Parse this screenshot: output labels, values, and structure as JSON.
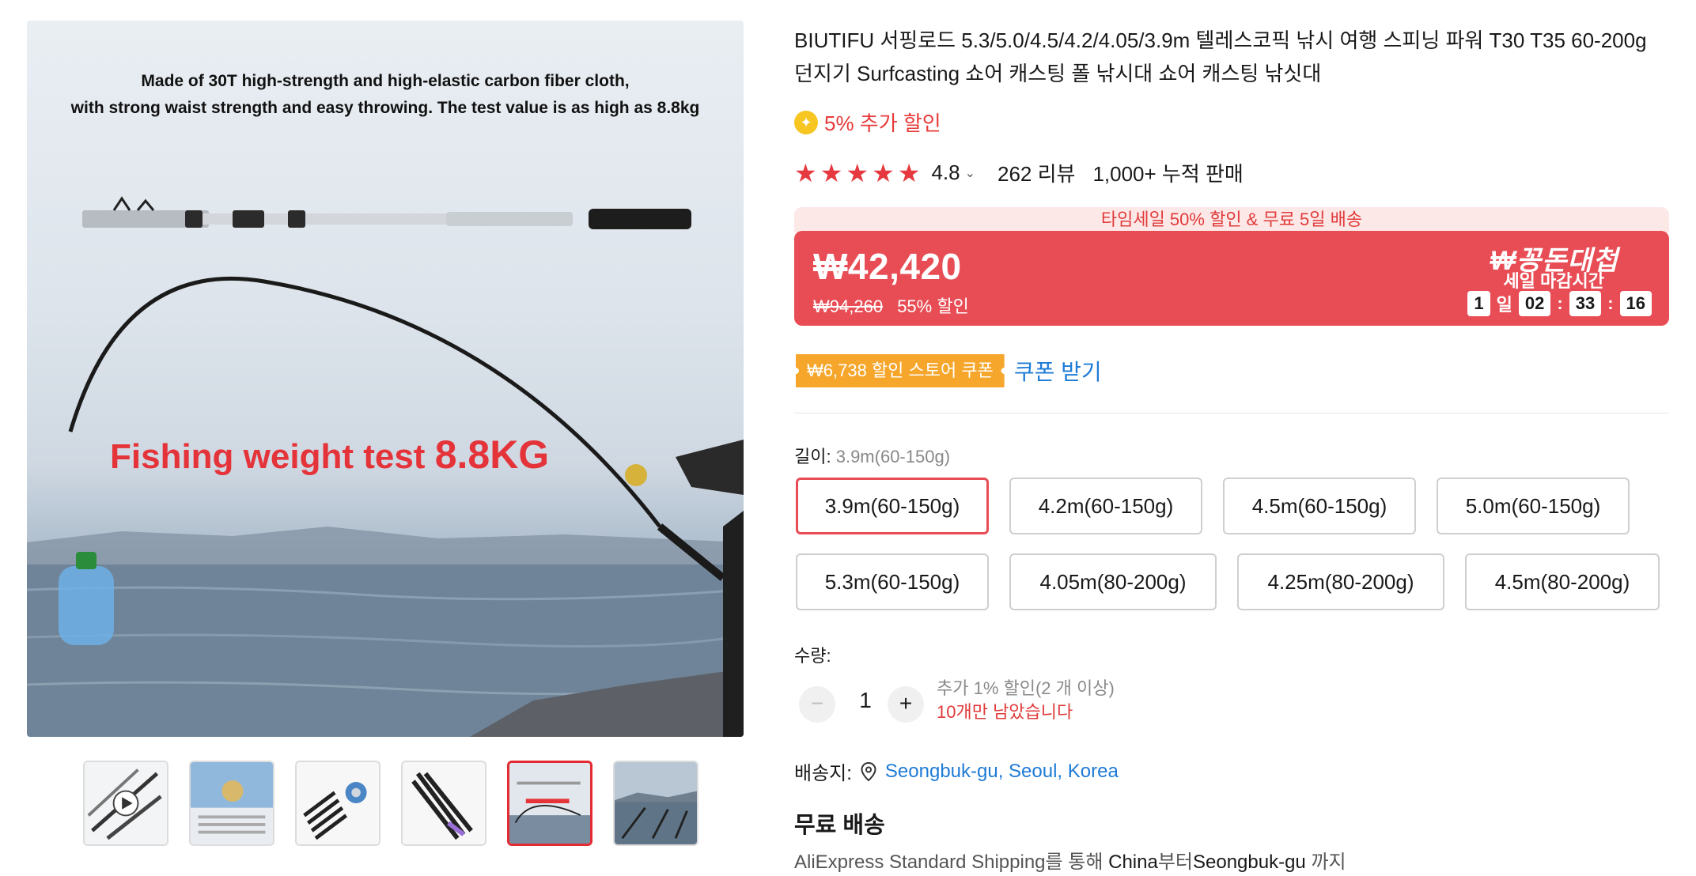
{
  "gallery": {
    "caption_line1": "Made of 30T high-strength and high-elastic carbon fiber cloth,",
    "caption_line2": "with strong waist strength and easy throwing. The test value is as high as 8.8kg",
    "headline": "Fishing weight test",
    "headline_value": "8.8KG",
    "thumbnails": [
      {
        "name": "thumb-1",
        "has_play_icon": true
      },
      {
        "name": "thumb-2"
      },
      {
        "name": "thumb-3"
      },
      {
        "name": "thumb-4"
      },
      {
        "name": "thumb-5",
        "active": true
      },
      {
        "name": "thumb-6"
      }
    ]
  },
  "product": {
    "title": "BIUTIFU 서핑로드 5.3/5.0/4.5/4.2/4.05/3.9m 텔레스코픽 낚시 여행 스피닝 파워 T30 T35 60-200g 던지기 Surfcasting 쇼어 캐스팅 폴 낚시대 쇼어 캐스팅 낚싯대",
    "extra_discount": "5% 추가 할인",
    "rating": "4.8",
    "stars": 5,
    "reviews": "262 리뷰",
    "sold": "1,000+ 누적 판매"
  },
  "price": {
    "banner": "타임세일 50% 할인 & 무료 5일 배송",
    "current": "₩42,420",
    "original": "₩94,260",
    "discount": "55% 할인",
    "brand_mark": "₩꽁돈대첩",
    "deadline_label": "세일 마감시간",
    "countdown": {
      "days": "1",
      "days_unit": "일",
      "hours": "02",
      "minutes": "33",
      "seconds": "16"
    }
  },
  "coupon": {
    "badge": "₩6,738 할인 스토어 쿠폰",
    "action": "쿠폰 받기"
  },
  "options": {
    "label": "길이:",
    "selected": "3.9m(60-150g)",
    "items": [
      "3.9m(60-150g)",
      "4.2m(60-150g)",
      "4.5m(60-150g)",
      "5.0m(60-150g)",
      "5.3m(60-150g)",
      "4.05m(80-200g)",
      "4.25m(80-200g)",
      "4.5m(80-200g)"
    ]
  },
  "quantity": {
    "label": "수량:",
    "minus": "−",
    "value": "1",
    "plus": "+",
    "note": "추가 1% 할인(2 개 이상)",
    "warning": "10개만 남았습니다"
  },
  "shipping": {
    "label": "배송지:",
    "location": "Seongbuk-gu, Seoul, Korea",
    "free": "무료 배송",
    "desc_service": "AliExpress Standard Shipping",
    "desc_by": "를 통해 ",
    "desc_from": "China",
    "desc_from_suffix": "부터",
    "desc_to": "Seongbuk-gu",
    "desc_to_suffix": " 까지"
  },
  "colors": {
    "accent_red": "#e84d55",
    "link_blue": "#1e7bd6",
    "coupon_orange": "#f6a62b",
    "star_red": "#e5393f"
  }
}
